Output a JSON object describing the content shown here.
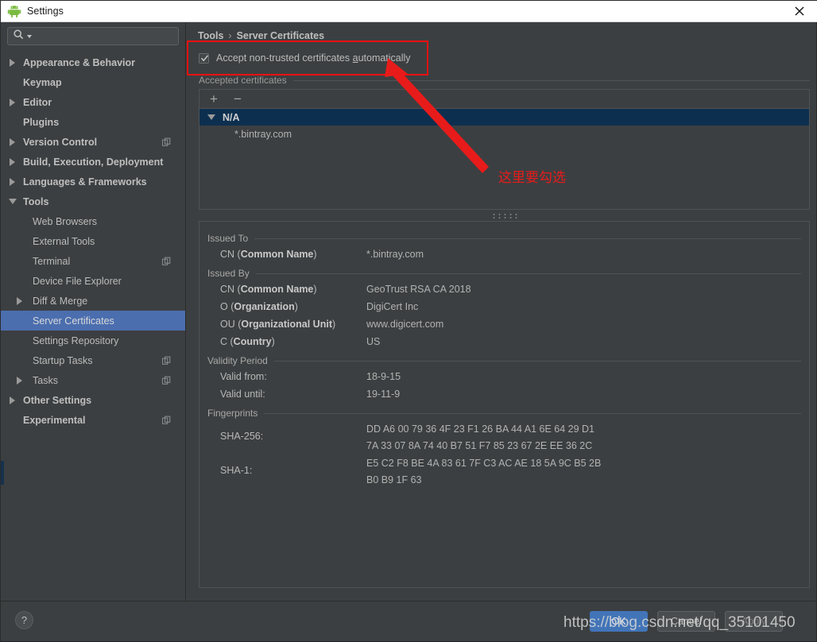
{
  "window": {
    "title": "Settings",
    "icon": "android-robot-icon",
    "close_icon": "close-icon"
  },
  "sidebar": {
    "search": {
      "placeholder": "",
      "value": "",
      "icon": "search-icon",
      "dropdown_icon": "chevron-down-icon"
    },
    "items": [
      {
        "label": "Appearance & Behavior",
        "level": 0,
        "arrow": "right",
        "bold": true,
        "selected": false,
        "copy": false
      },
      {
        "label": "Keymap",
        "level": 0,
        "arrow": "none",
        "bold": true,
        "selected": false,
        "copy": false
      },
      {
        "label": "Editor",
        "level": 0,
        "arrow": "right",
        "bold": true,
        "selected": false,
        "copy": false
      },
      {
        "label": "Plugins",
        "level": 0,
        "arrow": "none",
        "bold": true,
        "selected": false,
        "copy": false
      },
      {
        "label": "Version Control",
        "level": 0,
        "arrow": "right",
        "bold": true,
        "selected": false,
        "copy": true
      },
      {
        "label": "Build, Execution, Deployment",
        "level": 0,
        "arrow": "right",
        "bold": true,
        "selected": false,
        "copy": false
      },
      {
        "label": "Languages & Frameworks",
        "level": 0,
        "arrow": "right",
        "bold": true,
        "selected": false,
        "copy": false
      },
      {
        "label": "Tools",
        "level": 0,
        "arrow": "down",
        "bold": true,
        "selected": false,
        "copy": false
      },
      {
        "label": "Web Browsers",
        "level": 1,
        "arrow": "none",
        "bold": false,
        "selected": false,
        "copy": false
      },
      {
        "label": "External Tools",
        "level": 1,
        "arrow": "none",
        "bold": false,
        "selected": false,
        "copy": false
      },
      {
        "label": "Terminal",
        "level": 1,
        "arrow": "none",
        "bold": false,
        "selected": false,
        "copy": true
      },
      {
        "label": "Device File Explorer",
        "level": 1,
        "arrow": "none",
        "bold": false,
        "selected": false,
        "copy": false
      },
      {
        "label": "Diff & Merge",
        "level": 1,
        "arrow": "right",
        "bold": false,
        "selected": false,
        "copy": false
      },
      {
        "label": "Server Certificates",
        "level": 1,
        "arrow": "none",
        "bold": false,
        "selected": true,
        "copy": false
      },
      {
        "label": "Settings Repository",
        "level": 1,
        "arrow": "none",
        "bold": false,
        "selected": false,
        "copy": false
      },
      {
        "label": "Startup Tasks",
        "level": 1,
        "arrow": "none",
        "bold": false,
        "selected": false,
        "copy": true
      },
      {
        "label": "Tasks",
        "level": 1,
        "arrow": "right",
        "bold": false,
        "selected": false,
        "copy": true
      },
      {
        "label": "Other Settings",
        "level": 0,
        "arrow": "right",
        "bold": true,
        "selected": false,
        "copy": false
      },
      {
        "label": "Experimental",
        "level": 0,
        "arrow": "none",
        "bold": true,
        "selected": false,
        "copy": true
      }
    ]
  },
  "main": {
    "breadcrumb": {
      "parent": "Tools",
      "separator": "›",
      "current": "Server Certificates"
    },
    "auto_accept": {
      "checked": true,
      "label_before": "Accept non-trusted certificates ",
      "label_mnemonic": "a",
      "label_after": "utomatically"
    },
    "accepted_certificates": {
      "group_label": "Accepted certificates",
      "add_button": "+",
      "remove_button": "−",
      "tree": {
        "group_node": "N/A",
        "group_expanded": true,
        "children": [
          "*.bintray.com"
        ]
      }
    },
    "details": {
      "issued_to": {
        "title": "Issued To",
        "rows": [
          {
            "key_prefix": "CN (",
            "key_bold": "Common Name",
            "key_suffix": ")",
            "value": "*.bintray.com"
          }
        ]
      },
      "issued_by": {
        "title": "Issued By",
        "rows": [
          {
            "key_prefix": "CN (",
            "key_bold": "Common Name",
            "key_suffix": ")",
            "value": "GeoTrust RSA CA 2018"
          },
          {
            "key_prefix": "O (",
            "key_bold": "Organization",
            "key_suffix": ")",
            "value": "DigiCert Inc"
          },
          {
            "key_prefix": "OU (",
            "key_bold": "Organizational Unit",
            "key_suffix": ")",
            "value": "www.digicert.com"
          },
          {
            "key_prefix": "C (",
            "key_bold": "Country",
            "key_suffix": ")",
            "value": "US"
          }
        ]
      },
      "validity_period": {
        "title": "Validity Period",
        "rows": [
          {
            "key": "Valid from:",
            "value": "18-9-15"
          },
          {
            "key": "Valid until:",
            "value": "19-11-9"
          }
        ]
      },
      "fingerprints": {
        "title": "Fingerprints",
        "rows": [
          {
            "key": "SHA-256:",
            "value": "DD A6 00 79 36 4F 23 F1 26 BA 44 A1 6E 64 29 D1\n7A 33 07 8A 74 40 B7 51 F7 85 23 67 2E EE 36 2C"
          },
          {
            "key": "SHA-1:",
            "value": "E5 C2 F8 BE 4A 83 61 7F C3 AC AE 18 5A 9C B5 2B\nB0 B9 1F 63"
          }
        ]
      }
    }
  },
  "footer": {
    "help_label": "?",
    "ok": "OK",
    "cancel": "Cancel",
    "apply": "Apply"
  },
  "annotations": {
    "callout_text": "这里要勾选",
    "watermark": "https://blog.csdn.net/qq_35101450",
    "highlight_color": "#ee1111"
  }
}
